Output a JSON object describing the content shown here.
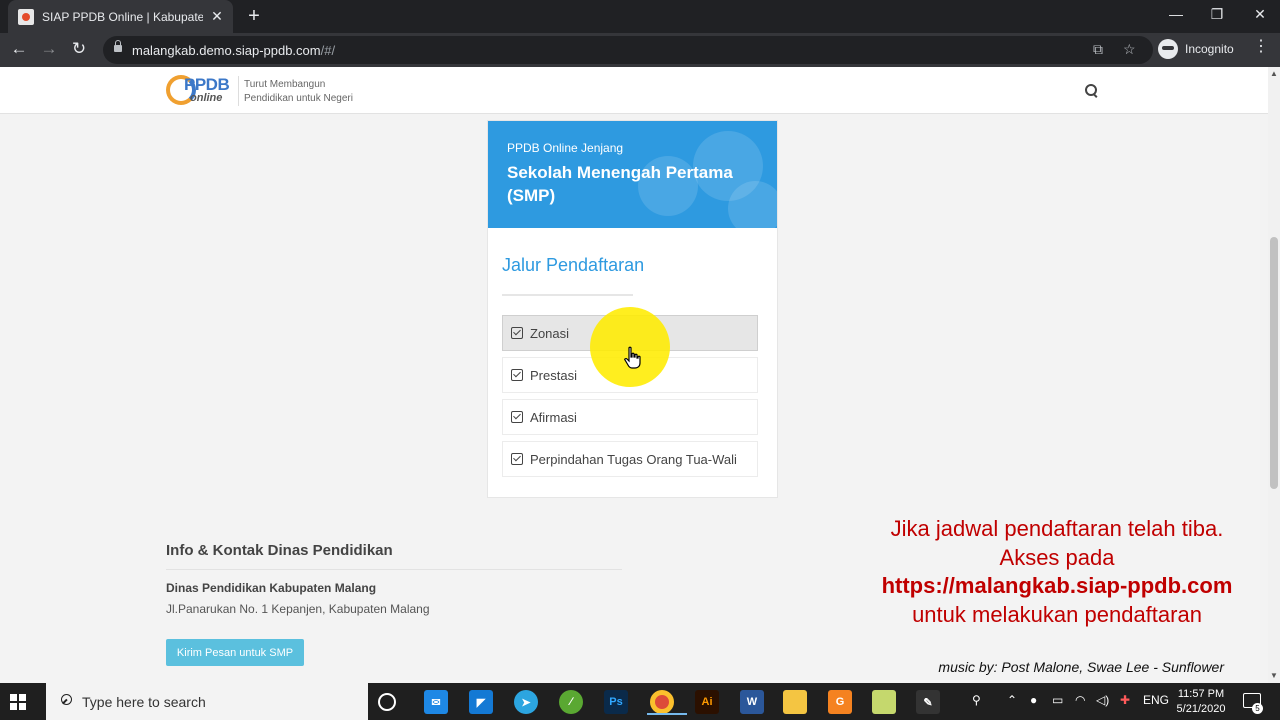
{
  "browser": {
    "tab_title": "SIAP PPDB Online | Kabupaten Malang",
    "tab_close": "✕",
    "new_tab": "+",
    "url_host": "malangkab.demo.siap-ppdb.com",
    "url_path": "/#/",
    "incognito_label": "Incognito",
    "window_controls": [
      "minimize",
      "restore",
      "close"
    ]
  },
  "site": {
    "logo_ppdb": "PPDB",
    "logo_online": "online",
    "tagline_line1": "Turut Membangun",
    "tagline_line2": "Pendidikan untuk Negeri"
  },
  "card": {
    "banner_small": "PPDB Online Jenjang",
    "banner_title": "Sekolah Menengah Pertama (SMP)",
    "jalur_title": "Jalur Pendaftaran",
    "options": [
      {
        "label": "Zonasi",
        "active": true
      },
      {
        "label": "Prestasi",
        "active": false
      },
      {
        "label": "Afirmasi",
        "active": false
      },
      {
        "label": "Perpindahan Tugas Orang Tua-Wali",
        "active": false
      }
    ]
  },
  "info": {
    "title": "Info & Kontak Dinas Pendidikan",
    "org": "Dinas Pendidikan Kabupaten Malang",
    "address": "Jl.Panarukan No. 1 Kepanjen, Kabupaten Malang",
    "button": "Kirim Pesan untuk SMP"
  },
  "overlay": {
    "line1": "Jika jadwal pendaftaran telah tiba. Akses pada ",
    "link": "https://malangkab.siap-ppdb.com",
    "line2": " untuk melakukan pendaftaran",
    "music": "music by: Post Malone, Swae Lee - Sunflower",
    "color": "#c00000"
  },
  "taskbar": {
    "search_placeholder": "Type here to search",
    "language": "ENG",
    "time": "11:57 PM",
    "date": "5/21/2020",
    "notification_count": "5",
    "apps": [
      "task-view",
      "mail",
      "store",
      "telegram",
      "app-green",
      "photoshop",
      "chrome",
      "illustrator",
      "word",
      "file-explorer",
      "app-orange",
      "app-yellow",
      "app-dark"
    ]
  },
  "colors": {
    "accent": "#2e9ae0",
    "button_info": "#5bc0de"
  }
}
